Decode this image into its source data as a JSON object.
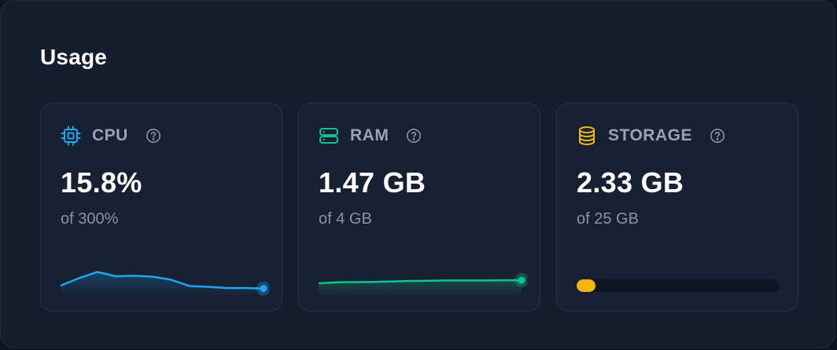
{
  "usage": {
    "title": "Usage",
    "cards": [
      {
        "key": "cpu",
        "label": "CPU",
        "value": "15.8%",
        "sub": "of 300%",
        "icon": "cpu-icon",
        "color": "#1ea7f0",
        "history": [
          0.2,
          0.52,
          0.78,
          0.6,
          0.62,
          0.58,
          0.45,
          0.18,
          0.15,
          0.1,
          0.1,
          0.08
        ]
      },
      {
        "key": "ram",
        "label": "RAM",
        "value": "1.47 GB",
        "sub": "of 4 GB",
        "icon": "server-icon",
        "color": "#10c48a",
        "history": [
          0.3,
          0.34,
          0.35,
          0.36,
          0.38,
          0.4,
          0.41,
          0.42,
          0.42,
          0.42,
          0.43,
          0.43
        ]
      },
      {
        "key": "storage",
        "label": "STORAGE",
        "value": "2.33 GB",
        "sub": "of 25 GB",
        "icon": "database-icon",
        "color": "#f5b70a",
        "fill_ratio": 0.093
      }
    ]
  }
}
